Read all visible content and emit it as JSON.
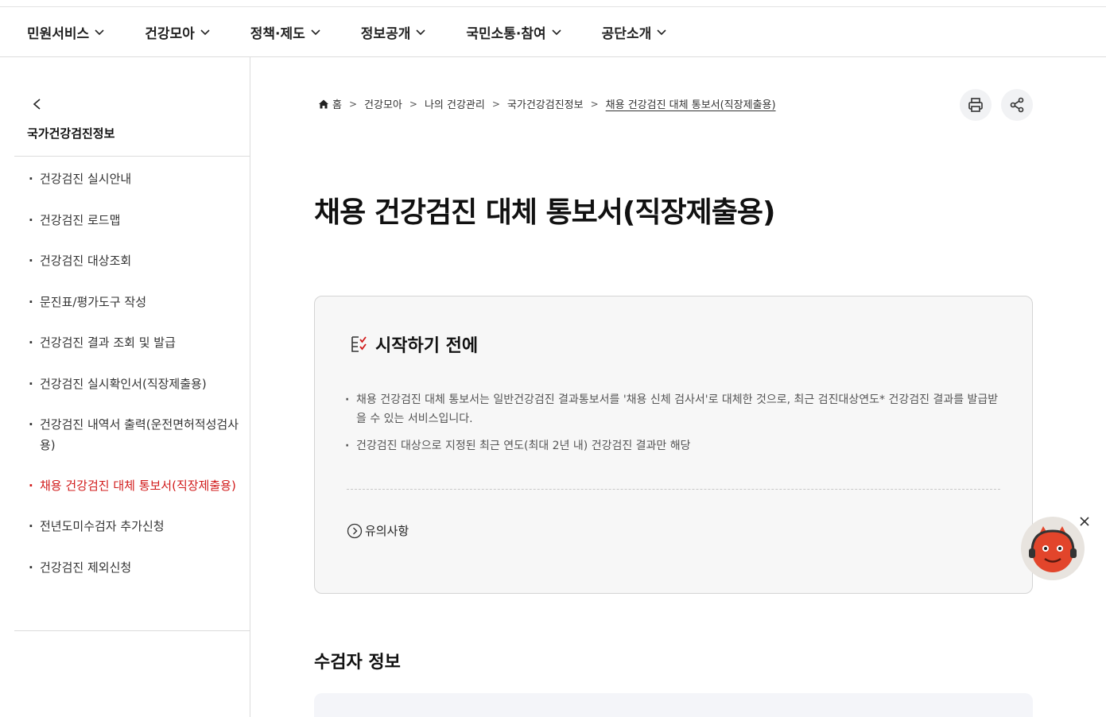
{
  "gnb": {
    "items": [
      {
        "label": "민원서비스"
      },
      {
        "label": "건강모아"
      },
      {
        "label": "정책·제도"
      },
      {
        "label": "정보공개"
      },
      {
        "label": "국민소통·참여"
      },
      {
        "label": "공단소개"
      }
    ]
  },
  "sidebar": {
    "title": "국가건강검진정보",
    "items": [
      {
        "label": "건강검진 실시안내"
      },
      {
        "label": "건강검진 로드맵"
      },
      {
        "label": "건강검진 대상조회"
      },
      {
        "label": "문진표/평가도구 작성"
      },
      {
        "label": "건강검진 결과 조회 및 발급"
      },
      {
        "label": "건강검진 실시확인서(직장제출용)"
      },
      {
        "label": "건강검진 내역서 출력(운전면허적성검사용)"
      },
      {
        "label": "채용 건강검진 대체 통보서(직장제출용)"
      },
      {
        "label": "전년도미수검자 추가신청"
      },
      {
        "label": "건강검진 제외신청"
      }
    ]
  },
  "breadcrumb": {
    "home": "홈",
    "items": [
      "건강모아",
      "나의 건강관리",
      "국가건강검진정보"
    ],
    "current": "채용 건강검진 대체 통보서(직장제출용)"
  },
  "page": {
    "title": "채용 건강검진 대체 통보서(직장제출용)"
  },
  "info_box": {
    "heading": "시작하기 전에",
    "bullets": [
      "채용 건강검진 대체 통보서는 일반건강검진 결과통보서를 '채용 신체 검사서'로 대체한 것으로, 최근 검진대상연도* 건강검진 결과를 발급받을 수 있는 서비스입니다.",
      "건강검진 대상으로 지정된 최근 연도(최대 2년 내) 건강검진 결과만 해당"
    ],
    "notice_link": "유의사항"
  },
  "section": {
    "title": "수검자 정보"
  },
  "colors": {
    "accent_red": "#d11a1a",
    "box_bg": "#f7f7f7",
    "section_bg": "#f4f5f9"
  }
}
